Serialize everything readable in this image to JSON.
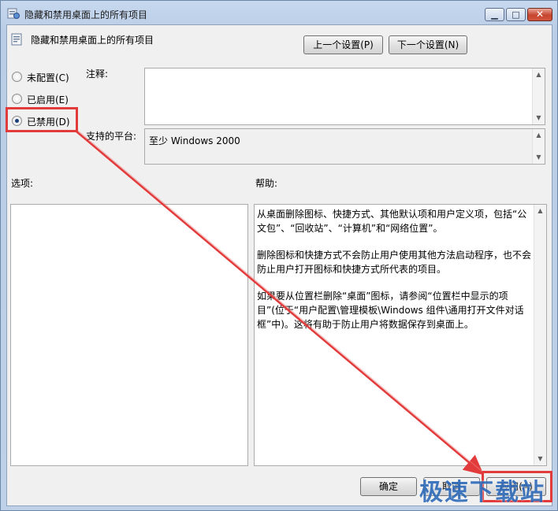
{
  "window": {
    "title": "隐藏和禁用桌面上的所有项目",
    "minimize_glyph": "▁",
    "maximize_glyph": "□",
    "close_glyph": "✕"
  },
  "header": {
    "policy_name": "隐藏和禁用桌面上的所有项目",
    "prev_button": "上一个设置(P)",
    "next_button": "下一个设置(N)"
  },
  "state": {
    "options": [
      {
        "label": "未配置(C)",
        "checked": false
      },
      {
        "label": "已启用(E)",
        "checked": false
      },
      {
        "label": "已禁用(D)",
        "checked": true
      }
    ]
  },
  "comment": {
    "label": "注释:",
    "value": ""
  },
  "platform": {
    "label": "支持的平台:",
    "value": "至少 Windows 2000"
  },
  "options_panel": {
    "label": "选项:"
  },
  "help_panel": {
    "label": "帮助:",
    "paragraphs": [
      "从桌面删除图标、快捷方式、其他默认项和用户定义项，包括“公文包”、“回收站”、“计算机”和“网络位置”。",
      "删除图标和快捷方式不会防止用户使用其他方法启动程序，也不会防止用户打开图标和快捷方式所代表的项目。",
      "如果要从位置栏删除“桌面”图标，请参阅“位置栏中显示的项目”(位于“用户配置\\管理模板\\Windows 组件\\通用打开文件对话框”中)。这将有助于防止用户将数据保存到桌面上。"
    ]
  },
  "footer": {
    "ok_button": "确定",
    "cancel_button": "取消",
    "apply_button": "应用(A)"
  },
  "scroll_glyphs": {
    "up": "▲",
    "down": "▼"
  },
  "watermark": "极速下载站",
  "colors": {
    "highlight": "#e23b3b",
    "accent": "#1c3f7c"
  }
}
